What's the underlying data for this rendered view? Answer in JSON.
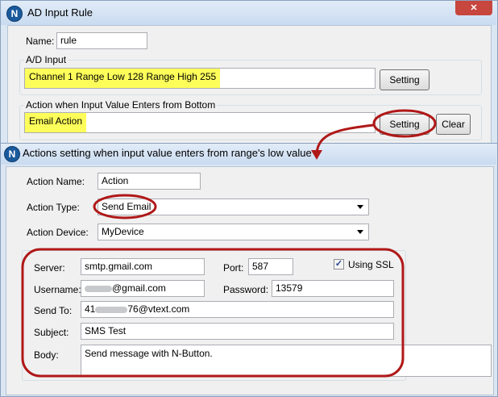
{
  "main_window": {
    "title": "AD Input Rule",
    "name_label": "Name:",
    "name_value": "rule",
    "ad_input_group_label": "A/D Input",
    "ad_input_value": "Channel 1  Range Low 128  Range High 255",
    "ad_setting_button": "Setting",
    "action_group_label": "Action when Input Value Enters from Bottom",
    "action_value": "Email Action",
    "action_setting_button": "Setting",
    "clear_button": "Clear"
  },
  "dialog": {
    "title": "Actions setting when input value enters from range's low value",
    "action_name_label": "Action Name:",
    "action_name_value": "Action",
    "action_type_label": "Action Type:",
    "action_type_value": "Send Email",
    "action_device_label": "Action Device:",
    "action_device_value": "MyDevice",
    "email": {
      "server_label": "Server:",
      "server_value": "smtp.gmail.com",
      "port_label": "Port:",
      "port_value": "587",
      "ssl_label": "Using SSL",
      "ssl_checked": true,
      "username_label": "Username:",
      "username_value": "@gmail.com",
      "password_label": "Password:",
      "password_value": "13579",
      "sendto_label": "Send To:",
      "sendto_prefix": "41",
      "sendto_suffix": "76@vtext.com",
      "subject_label": "Subject:",
      "subject_value": "SMS Test",
      "body_label": "Body:",
      "body_value": "Send message with N-Button."
    }
  },
  "icons": {
    "app_icon_glyph": "N",
    "close_icon_glyph": "✕"
  },
  "colors": {
    "highlight": "#fefe5a",
    "annotation_red": "#b01818",
    "close_button": "#c7463e"
  }
}
